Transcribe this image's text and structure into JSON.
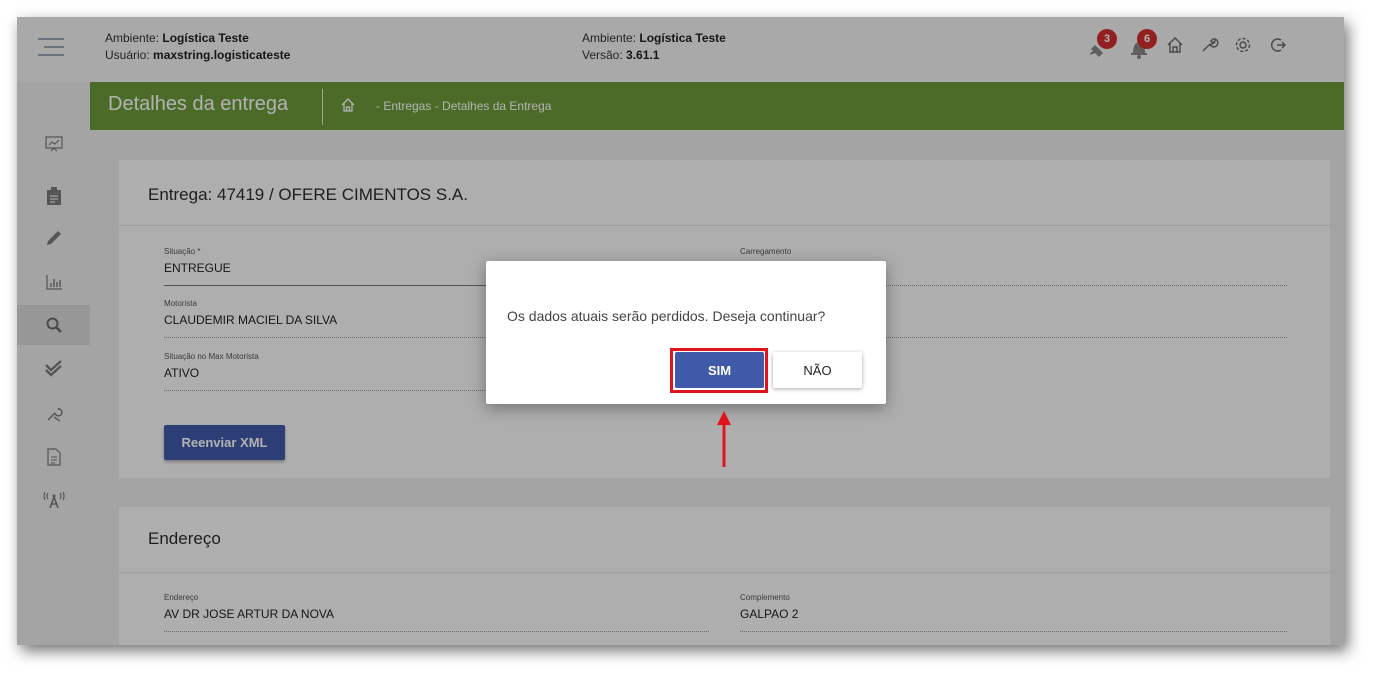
{
  "header": {
    "env_left": {
      "label": "Ambiente:",
      "value": "Logística Teste"
    },
    "user": {
      "label": "Usuário:",
      "value": "maxstring.logisticateste"
    },
    "env_center": {
      "label": "Ambiente:",
      "value": "Logística Teste"
    },
    "version": {
      "label": "Versão:",
      "value": "3.61.1"
    },
    "icons": {
      "satellite_badge": "3",
      "bell_badge": "6",
      "names": [
        "satellite-icon",
        "bell-icon",
        "home-icon",
        "wrench-icon",
        "settings-icon",
        "logout-icon"
      ]
    }
  },
  "titlebar": {
    "title": "Detalhes da entrega",
    "breadcrumb": "- Entregas - Detalhes da Entrega"
  },
  "sidebar": {
    "items": [
      "dashboard-icon",
      "clipboard-icon",
      "pencil-icon",
      "bar-chart-icon",
      "search-icon",
      "double-check-icon",
      "tools-icon",
      "document-icon",
      "antenna-icon"
    ],
    "active_index": 4
  },
  "delivery_card": {
    "title": "Entrega: 47419 / OFERE CIMENTOS S.A.",
    "fields": {
      "situacao": {
        "label": "Situação *",
        "value": "ENTREGUE"
      },
      "carregamento": {
        "label": "Carregamento",
        "value": ""
      },
      "motorista": {
        "label": "Motorista",
        "value": "CLAUDEMIR MACIEL DA SILVA"
      },
      "situacao_max": {
        "label": "Situação no Max Motorista",
        "value": "ATIVO"
      }
    },
    "resend_button": "Reenviar XML"
  },
  "address_card": {
    "title": "Endereço",
    "fields": {
      "endereco": {
        "label": "Endereço",
        "value": "AV DR JOSE ARTUR DA NOVA"
      },
      "complemento": {
        "label": "Complemento",
        "value": "GALPAO 2"
      }
    }
  },
  "dialog": {
    "message": "Os dados atuais serão perdidos. Deseja continuar?",
    "yes": "SIM",
    "no": "NÃO"
  },
  "colors": {
    "green_bar": "#6e9a3c",
    "primary_button": "#3f5aa8",
    "badge": "#d32f2f",
    "highlight": "#e0141c"
  }
}
